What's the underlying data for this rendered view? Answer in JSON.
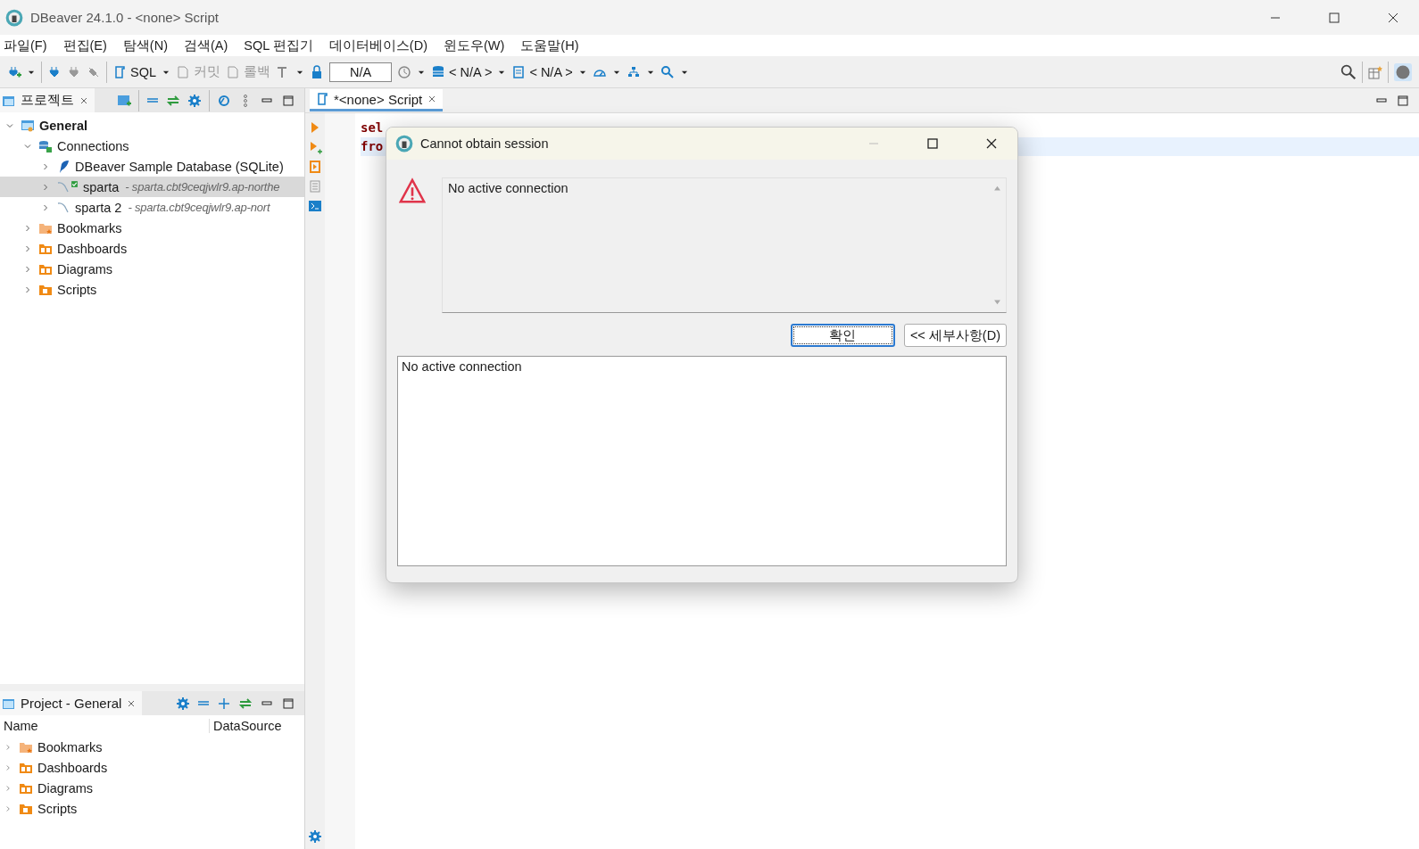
{
  "window": {
    "title": "DBeaver 24.1.0 - <none> Script"
  },
  "menu": [
    "파일(F)",
    "편집(E)",
    "탐색(N)",
    "검색(A)",
    "SQL 편집기",
    "데이터베이스(D)",
    "윈도우(W)",
    "도움말(H)"
  ],
  "toolbar": {
    "sql": "SQL",
    "commit": {
      "label": "커밋",
      "disabled": true
    },
    "rollback": {
      "label": "롤백",
      "disabled": true
    },
    "transaction_field": "N/A",
    "datasource": "< N/A >",
    "schema": "< N/A >"
  },
  "project_panel": {
    "tab": "프로젝트",
    "tree": [
      {
        "label": "General",
        "kind": "project",
        "expanded": true,
        "selected": false,
        "children": [
          {
            "label": "Connections",
            "kind": "connections",
            "expanded": true,
            "selected": false,
            "children": [
              {
                "label": "DBeaver Sample Database (SQLite)",
                "kind": "sqlite",
                "expanded": false,
                "selected": false,
                "connected": false
              },
              {
                "label": "sparta",
                "detail": "- sparta.cbt9ceqjwlr9.ap-northe",
                "kind": "mysql",
                "expanded": false,
                "selected": true,
                "connected": true
              },
              {
                "label": "sparta 2",
                "detail": "- sparta.cbt9ceqjwlr9.ap-nort",
                "kind": "mysql",
                "expanded": false,
                "selected": false,
                "connected": false
              }
            ]
          },
          {
            "label": "Bookmarks",
            "kind": "bookmarks",
            "expanded": false,
            "selected": false
          },
          {
            "label": "Dashboards",
            "kind": "dashboards",
            "expanded": false,
            "selected": false
          },
          {
            "label": "Diagrams",
            "kind": "diagrams",
            "expanded": false,
            "selected": false
          },
          {
            "label": "Scripts",
            "kind": "scripts",
            "expanded": false,
            "selected": false
          }
        ]
      }
    ]
  },
  "project_general_panel": {
    "tab": "Project - General",
    "columns": [
      "Name",
      "DataSource"
    ],
    "items": [
      {
        "label": "Bookmarks",
        "kind": "bookmarks"
      },
      {
        "label": "Dashboards",
        "kind": "dashboards"
      },
      {
        "label": "Diagrams",
        "kind": "diagrams"
      },
      {
        "label": "Scripts",
        "kind": "scripts"
      }
    ]
  },
  "editor": {
    "tab": "*<none> Script",
    "lines": [
      "sel",
      "fro"
    ]
  },
  "dialog": {
    "title": "Cannot obtain session",
    "message": "No active connection",
    "buttons": [
      {
        "label": "확인",
        "default": true
      },
      {
        "label": "<< 세부사항(D)",
        "default": false
      }
    ],
    "details": "No active connection"
  }
}
